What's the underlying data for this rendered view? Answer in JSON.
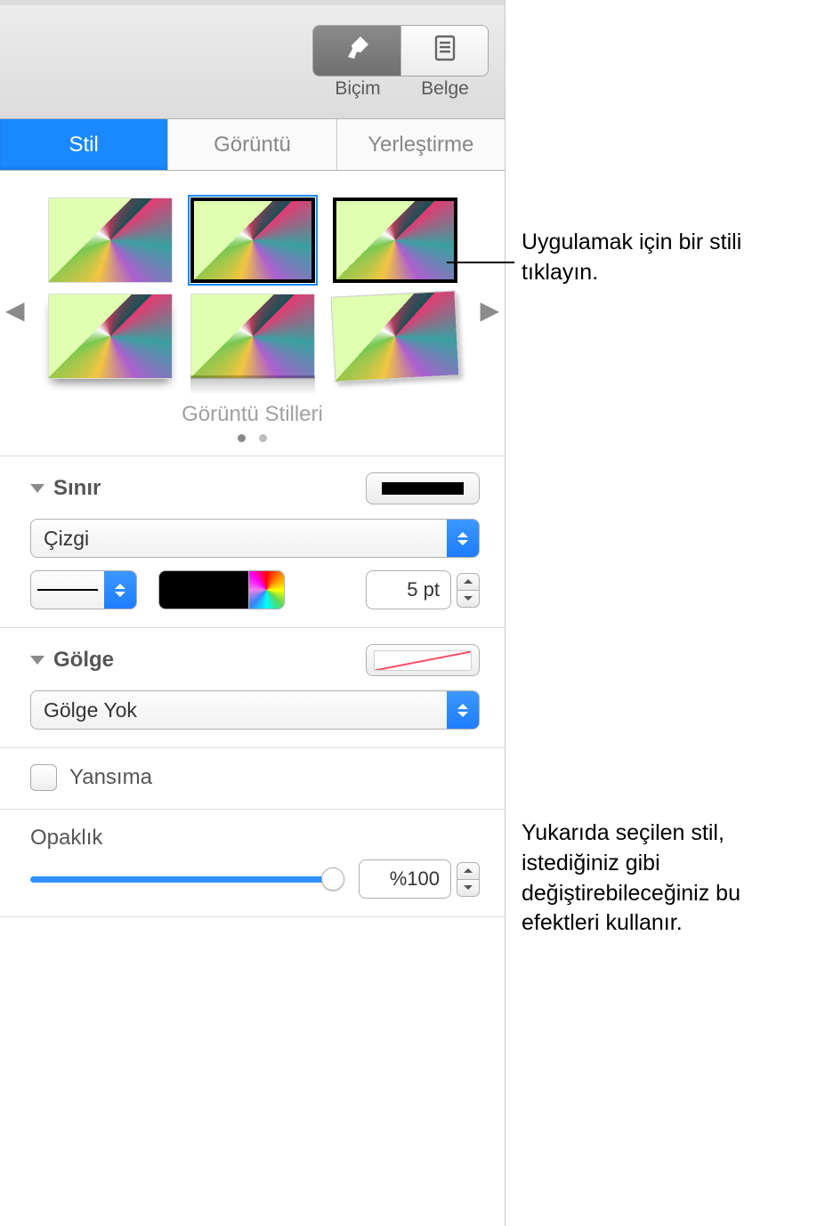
{
  "toolbar": {
    "format_label": "Biçim",
    "document_label": "Belge"
  },
  "tabs": {
    "style": "Stil",
    "image": "Görüntü",
    "arrange": "Yerleştirme"
  },
  "gallery": {
    "caption": "Görüntü Stilleri"
  },
  "border": {
    "title": "Sınır",
    "type": "Çizgi",
    "width_value": "5 pt"
  },
  "shadow": {
    "title": "Gölge",
    "value": "Gölge Yok"
  },
  "reflection": {
    "label": "Yansıma"
  },
  "opacity": {
    "label": "Opaklık",
    "value": "%100"
  },
  "callouts": {
    "c1": "Uygulamak için bir stili tıklayın.",
    "c2": "Yukarıda seçilen stil, istediğiniz gibi değiştirebileceğiniz bu efektleri kullanır."
  }
}
